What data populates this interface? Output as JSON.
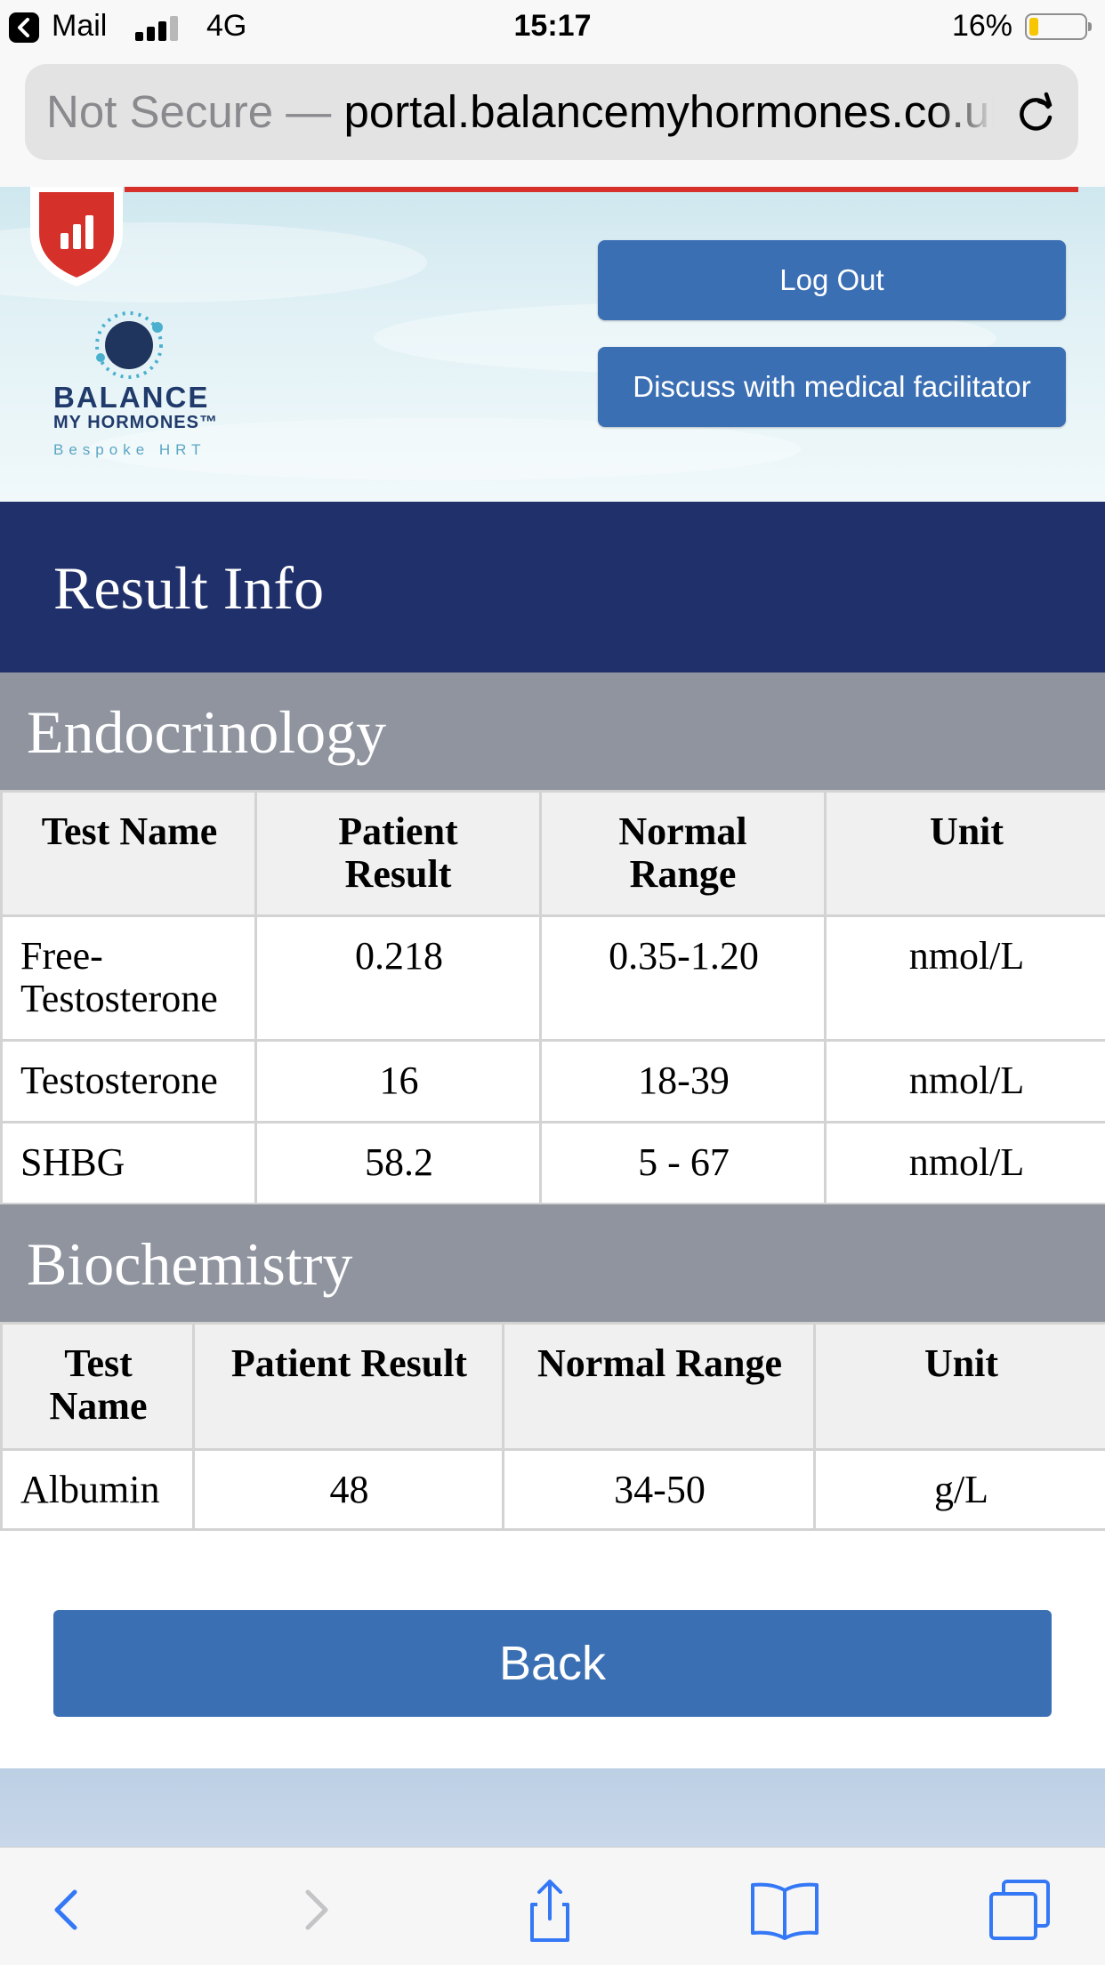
{
  "status_bar": {
    "back_app": "Mail",
    "network": "4G",
    "time": "15:17",
    "battery_percent": "16%",
    "battery_level": 0.16,
    "signal_bars": 3
  },
  "browser": {
    "security_label": "Not Secure —",
    "url": "portal.balancemyhormones.co.uk"
  },
  "header": {
    "brand_line1": "BALANCE",
    "brand_line2": "MY HORMONES™",
    "brand_tagline": "Bespoke HRT",
    "logout_label": "Log Out",
    "discuss_label": "Discuss with medical facilitator"
  },
  "page_title": "Result Info",
  "endocrinology": {
    "title": "Endocrinology",
    "columns": [
      "Test Name",
      "Patient Result",
      "Normal Range",
      "Unit"
    ],
    "rows": [
      {
        "name": "Free-Testosterone",
        "result": "0.218",
        "range": "0.35-1.20",
        "unit": "nmol/L"
      },
      {
        "name": "Testosterone",
        "result": "16",
        "range": "18-39",
        "unit": "nmol/L"
      },
      {
        "name": "SHBG",
        "result": "58.2",
        "range": "5 - 67",
        "unit": "nmol/L"
      }
    ]
  },
  "biochemistry": {
    "title": "Biochemistry",
    "columns": [
      "Test Name",
      "Patient Result",
      "Normal Range",
      "Unit"
    ],
    "rows": [
      {
        "name": "Albumin",
        "result": "48",
        "range": "34-50",
        "unit": "g/L"
      }
    ]
  },
  "back_label": "Back",
  "colors": {
    "banner": "#20306a",
    "section_header": "#8f949f",
    "button": "#3b6fb4",
    "accent_red": "#d6302b"
  },
  "toolbar_icons": [
    "back-icon",
    "forward-icon",
    "share-icon",
    "bookmarks-icon",
    "tabs-icon"
  ]
}
